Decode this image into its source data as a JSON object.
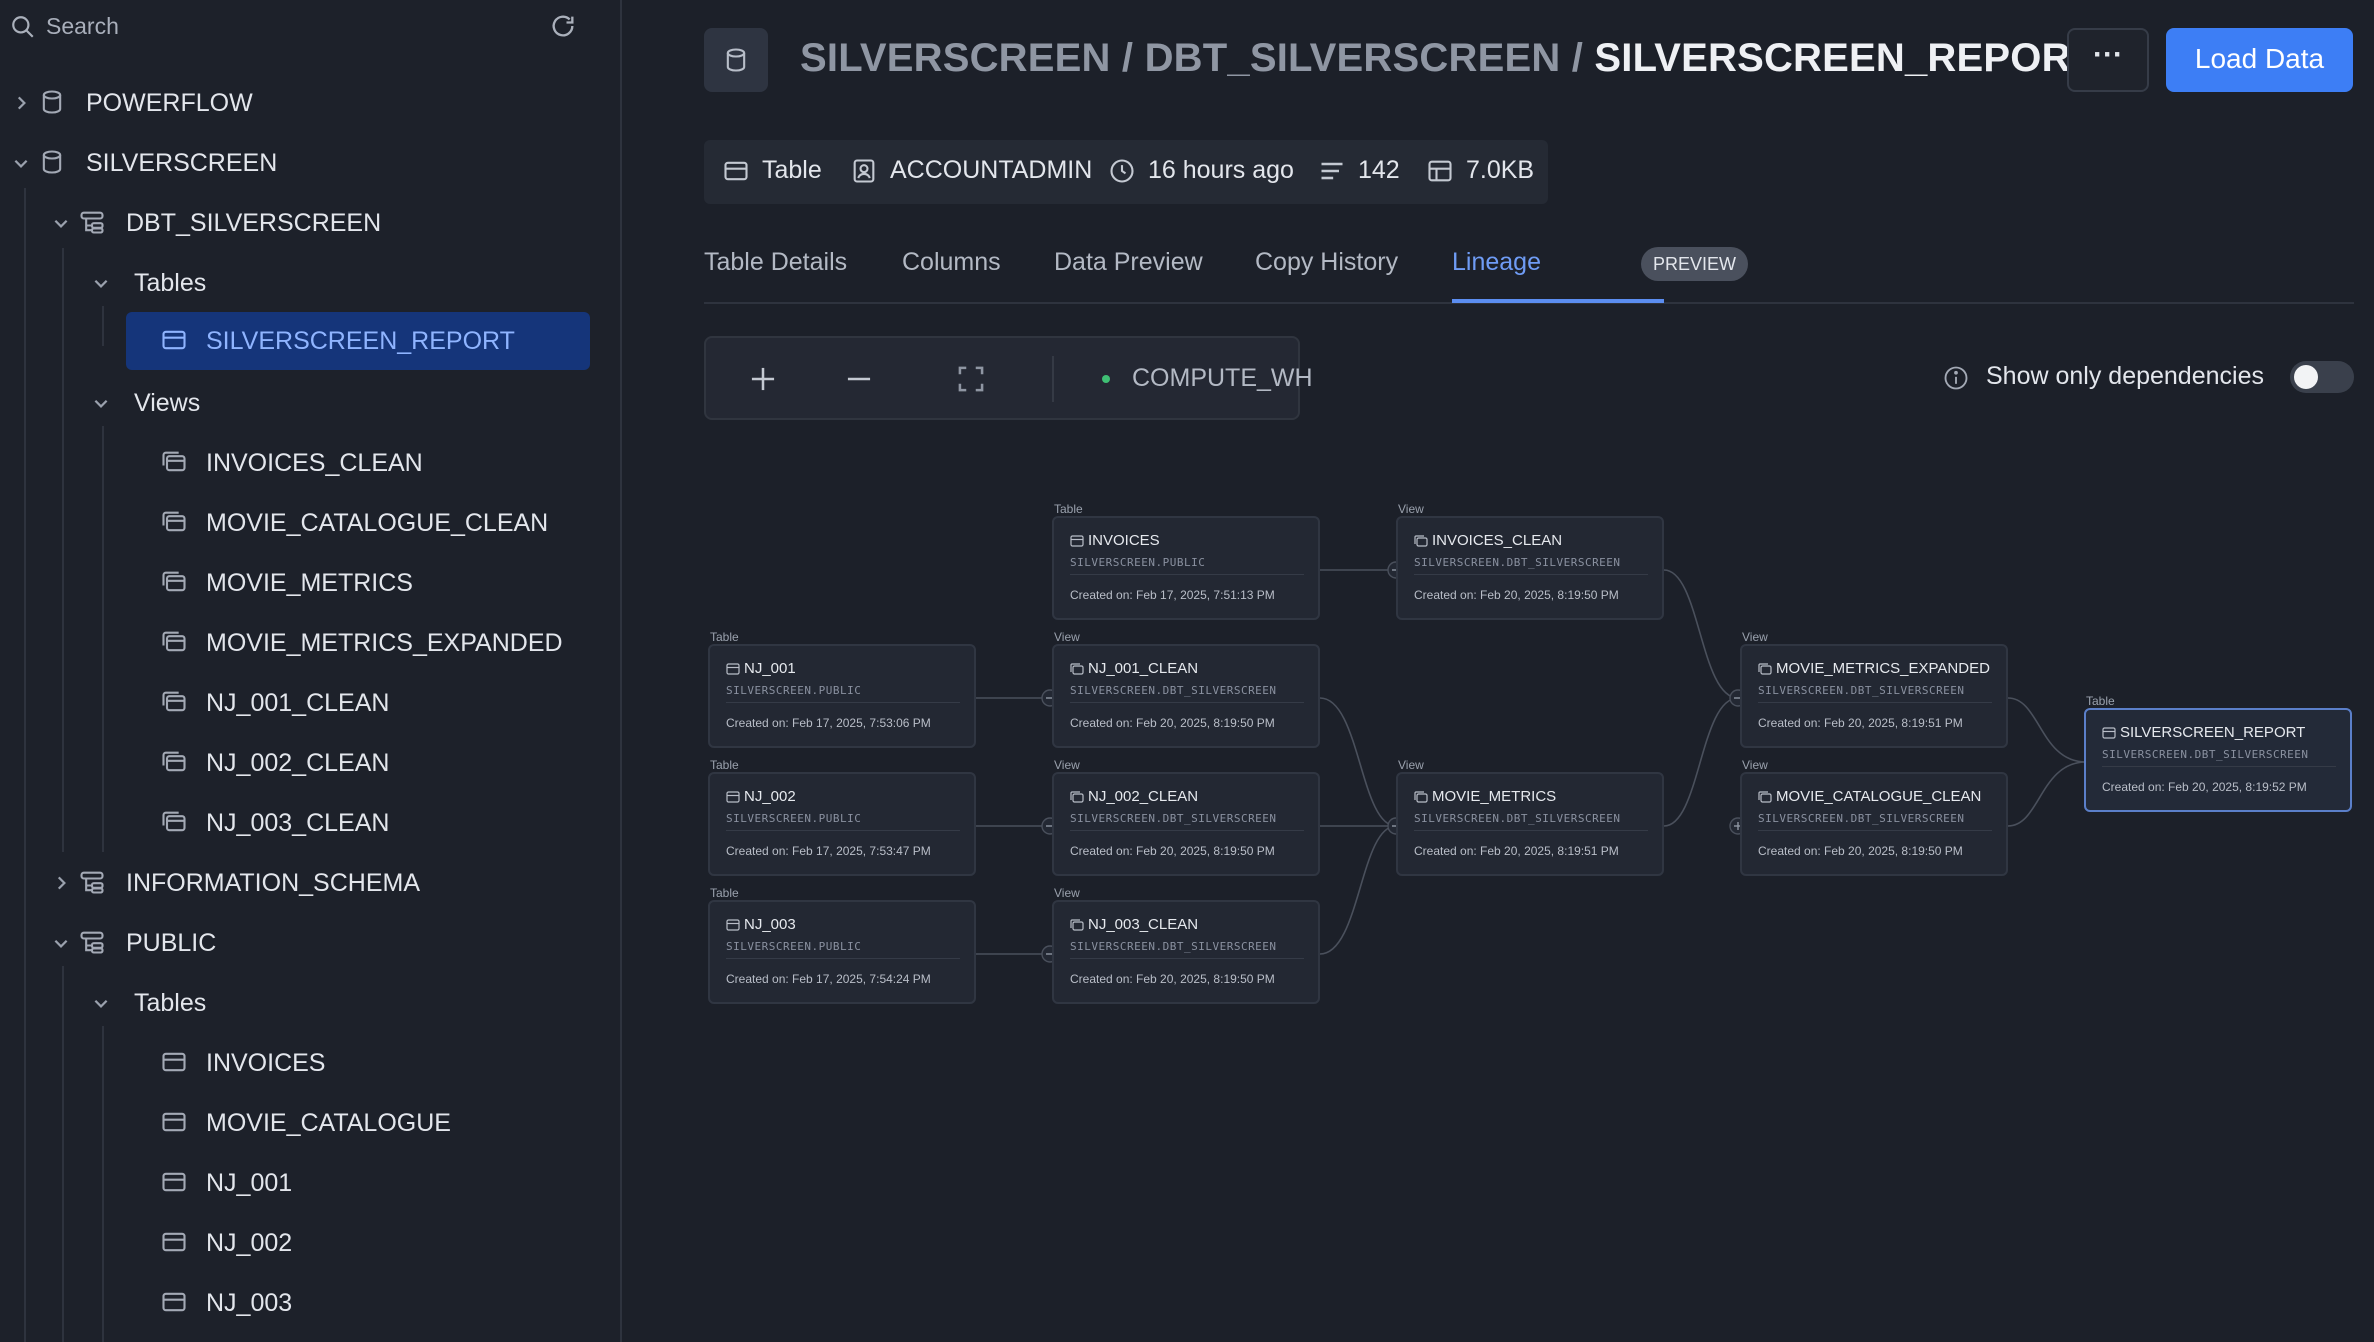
{
  "sidebar": {
    "search_placeholder": "Search",
    "items": [
      {
        "label": "POWERFLOW"
      },
      {
        "label": "SILVERSCREEN"
      },
      {
        "label": "DBT_SILVERSCREEN"
      },
      {
        "label": "Tables"
      },
      {
        "label": "SILVERSCREEN_REPORT"
      },
      {
        "label": "Views"
      },
      {
        "label": "INVOICES_CLEAN"
      },
      {
        "label": "MOVIE_CATALOGUE_CLEAN"
      },
      {
        "label": "MOVIE_METRICS"
      },
      {
        "label": "MOVIE_METRICS_EXPANDED"
      },
      {
        "label": "NJ_001_CLEAN"
      },
      {
        "label": "NJ_002_CLEAN"
      },
      {
        "label": "NJ_003_CLEAN"
      },
      {
        "label": "INFORMATION_SCHEMA"
      },
      {
        "label": "PUBLIC"
      },
      {
        "label": "Tables"
      },
      {
        "label": "INVOICES"
      },
      {
        "label": "MOVIE_CATALOGUE"
      },
      {
        "label": "NJ_001"
      },
      {
        "label": "NJ_002"
      },
      {
        "label": "NJ_003"
      }
    ]
  },
  "header": {
    "crumb_db": "SILVERSCREEN",
    "crumb_sep1": " / ",
    "crumb_schema": "DBT_SILVERSCREEN",
    "crumb_sep2": " / ",
    "crumb_object": "SILVERSCREEN_REPORT",
    "more_label": "···",
    "load_label": "Load Data"
  },
  "meta": {
    "type": "Table",
    "owner": "ACCOUNTADMIN",
    "updated": "16 hours ago",
    "rows": "142",
    "size": "7.0KB"
  },
  "tabs": {
    "details": "Table Details",
    "columns": "Columns",
    "preview": "Data Preview",
    "copy_history": "Copy History",
    "lineage": "Lineage",
    "lineage_badge": "PREVIEW"
  },
  "lineage": {
    "warehouse": "COMPUTE_WH",
    "dependencies_label": "Show only dependencies",
    "nodes": [
      {
        "type": "Table",
        "name": "INVOICES",
        "schema": "SILVERSCREEN.PUBLIC",
        "created": "Created on: Feb 17, 2025, 7:51:13 PM"
      },
      {
        "type": "View",
        "name": "INVOICES_CLEAN",
        "schema": "SILVERSCREEN.DBT_SILVERSCREEN",
        "created": "Created on: Feb 20, 2025, 8:19:50 PM"
      },
      {
        "type": "Table",
        "name": "NJ_001",
        "schema": "SILVERSCREEN.PUBLIC",
        "created": "Created on: Feb 17, 2025, 7:53:06 PM"
      },
      {
        "type": "View",
        "name": "NJ_001_CLEAN",
        "schema": "SILVERSCREEN.DBT_SILVERSCREEN",
        "created": "Created on: Feb 20, 2025, 8:19:50 PM"
      },
      {
        "type": "View",
        "name": "MOVIE_METRICS_EXPANDED",
        "schema": "SILVERSCREEN.DBT_SILVERSCREEN",
        "created": "Created on: Feb 20, 2025, 8:19:51 PM"
      },
      {
        "type": "Table",
        "name": "SILVERSCREEN_REPORT",
        "schema": "SILVERSCREEN.DBT_SILVERSCREEN",
        "created": "Created on: Feb 20, 2025, 8:19:52 PM"
      },
      {
        "type": "Table",
        "name": "NJ_002",
        "schema": "SILVERSCREEN.PUBLIC",
        "created": "Created on: Feb 17, 2025, 7:53:47 PM"
      },
      {
        "type": "View",
        "name": "NJ_002_CLEAN",
        "schema": "SILVERSCREEN.DBT_SILVERSCREEN",
        "created": "Created on: Feb 20, 2025, 8:19:50 PM"
      },
      {
        "type": "View",
        "name": "MOVIE_METRICS",
        "schema": "SILVERSCREEN.DBT_SILVERSCREEN",
        "created": "Created on: Feb 20, 2025, 8:19:51 PM"
      },
      {
        "type": "View",
        "name": "MOVIE_CATALOGUE_CLEAN",
        "schema": "SILVERSCREEN.DBT_SILVERSCREEN",
        "created": "Created on: Feb 20, 2025, 8:19:50 PM"
      },
      {
        "type": "Table",
        "name": "NJ_003",
        "schema": "SILVERSCREEN.PUBLIC",
        "created": "Created on: Feb 17, 2025, 7:54:24 PM"
      },
      {
        "type": "View",
        "name": "NJ_003_CLEAN",
        "schema": "SILVERSCREEN.DBT_SILVERSCREEN",
        "created": "Created on: Feb 20, 2025, 8:19:50 PM"
      }
    ]
  }
}
